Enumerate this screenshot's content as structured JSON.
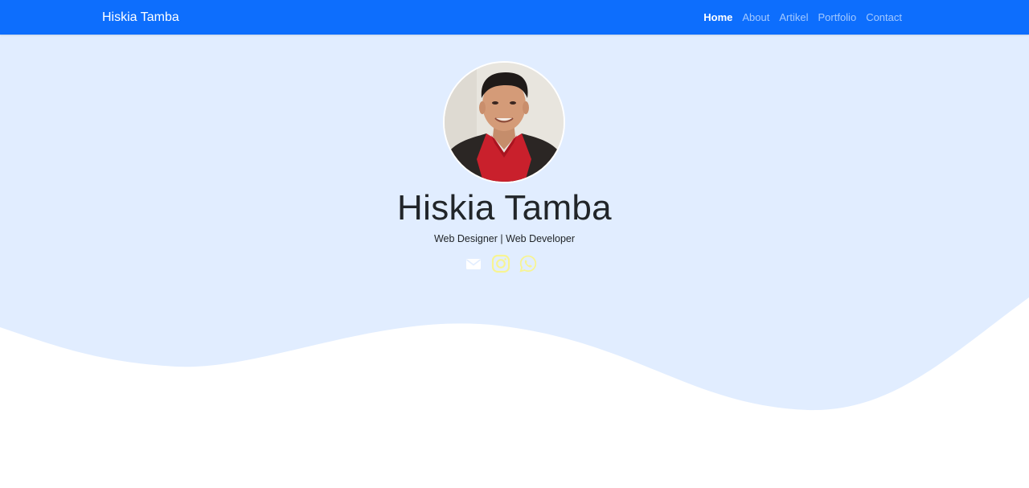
{
  "navbar": {
    "brand": "Hiskia Tamba",
    "links": [
      {
        "label": "Home",
        "active": true
      },
      {
        "label": "About",
        "active": false
      },
      {
        "label": "Artikel",
        "active": false
      },
      {
        "label": "Portfolio",
        "active": false
      },
      {
        "label": "Contact",
        "active": false
      }
    ]
  },
  "hero": {
    "name": "Hiskia Tamba",
    "subtitle": "Web Designer | Web Developer",
    "social": [
      {
        "icon": "email-icon"
      },
      {
        "icon": "instagram-icon"
      },
      {
        "icon": "whatsapp-icon"
      }
    ]
  },
  "colors": {
    "navbar": "#0d6efd",
    "hero_background": "#e1edff",
    "social_icon": "#fdfd96",
    "text": "#212529"
  }
}
